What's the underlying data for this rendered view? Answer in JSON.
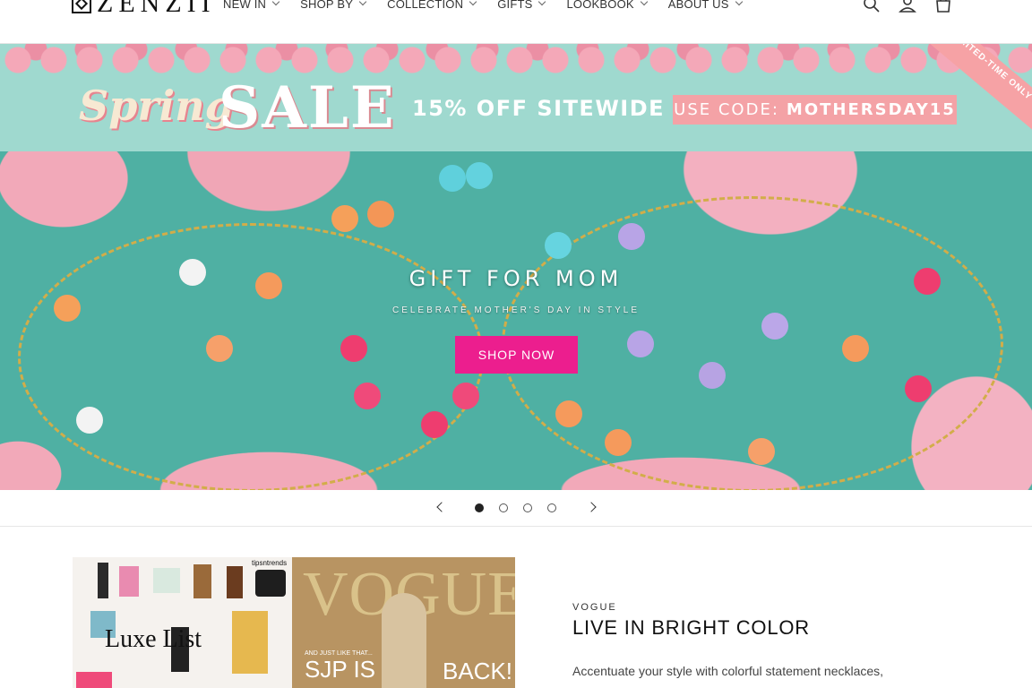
{
  "brand": {
    "name": "ZENZII"
  },
  "nav": {
    "items": [
      {
        "label": "NEW IN"
      },
      {
        "label": "SHOP BY"
      },
      {
        "label": "COLLECTION"
      },
      {
        "label": "GIFTS"
      },
      {
        "label": "LOOKBOOK"
      },
      {
        "label": "ABOUT US"
      }
    ]
  },
  "header_icons": [
    "search-icon",
    "account-icon",
    "cart-icon"
  ],
  "sale_banner": {
    "script_word": "Spring",
    "word": "SALE",
    "offer": "15% OFF SITEWIDE",
    "code_label": "USE CODE:",
    "code": "MOTHERSDAY15",
    "ribbon": "LIMITED-TIME ONLY"
  },
  "hero": {
    "title": "GIFT FOR MOM",
    "subtitle": "CELEBRATE MOTHER'S DAY IN STYLE",
    "button": "SHOP NOW",
    "button_color": "#ec1e8e"
  },
  "slider": {
    "slides": 4,
    "active": 1
  },
  "feature": {
    "image": {
      "magazine": "VOGUE",
      "left_text": "Luxe List",
      "sjp": "SJP IS",
      "back": "BACK!",
      "caption": "AND JUST LIKE THAT...",
      "tipsntrends": "tipsntrends"
    },
    "eyebrow": "VOGUE",
    "title": "LIVE IN BRIGHT COLOR",
    "body": "Accentuate your style with colorful statement necklaces,"
  },
  "colors": {
    "banner_bg": "#9fd9cf",
    "hero_bg": "#4fb0a3",
    "code_bg": "#f4a2a6"
  }
}
